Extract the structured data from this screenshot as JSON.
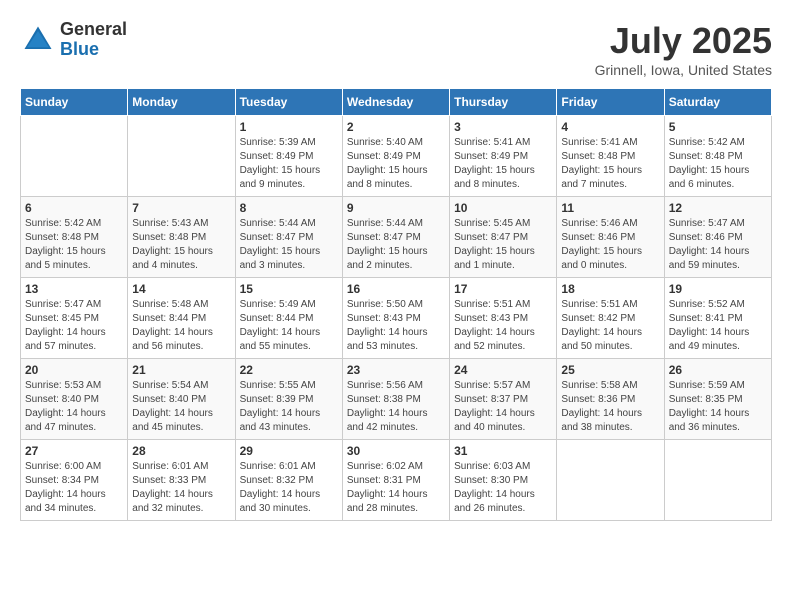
{
  "header": {
    "logo_general": "General",
    "logo_blue": "Blue",
    "month_year": "July 2025",
    "location": "Grinnell, Iowa, United States"
  },
  "days_of_week": [
    "Sunday",
    "Monday",
    "Tuesday",
    "Wednesday",
    "Thursday",
    "Friday",
    "Saturday"
  ],
  "weeks": [
    [
      {
        "day": "",
        "info": ""
      },
      {
        "day": "",
        "info": ""
      },
      {
        "day": "1",
        "info": "Sunrise: 5:39 AM\nSunset: 8:49 PM\nDaylight: 15 hours and 9 minutes."
      },
      {
        "day": "2",
        "info": "Sunrise: 5:40 AM\nSunset: 8:49 PM\nDaylight: 15 hours and 8 minutes."
      },
      {
        "day": "3",
        "info": "Sunrise: 5:41 AM\nSunset: 8:49 PM\nDaylight: 15 hours and 8 minutes."
      },
      {
        "day": "4",
        "info": "Sunrise: 5:41 AM\nSunset: 8:48 PM\nDaylight: 15 hours and 7 minutes."
      },
      {
        "day": "5",
        "info": "Sunrise: 5:42 AM\nSunset: 8:48 PM\nDaylight: 15 hours and 6 minutes."
      }
    ],
    [
      {
        "day": "6",
        "info": "Sunrise: 5:42 AM\nSunset: 8:48 PM\nDaylight: 15 hours and 5 minutes."
      },
      {
        "day": "7",
        "info": "Sunrise: 5:43 AM\nSunset: 8:48 PM\nDaylight: 15 hours and 4 minutes."
      },
      {
        "day": "8",
        "info": "Sunrise: 5:44 AM\nSunset: 8:47 PM\nDaylight: 15 hours and 3 minutes."
      },
      {
        "day": "9",
        "info": "Sunrise: 5:44 AM\nSunset: 8:47 PM\nDaylight: 15 hours and 2 minutes."
      },
      {
        "day": "10",
        "info": "Sunrise: 5:45 AM\nSunset: 8:47 PM\nDaylight: 15 hours and 1 minute."
      },
      {
        "day": "11",
        "info": "Sunrise: 5:46 AM\nSunset: 8:46 PM\nDaylight: 15 hours and 0 minutes."
      },
      {
        "day": "12",
        "info": "Sunrise: 5:47 AM\nSunset: 8:46 PM\nDaylight: 14 hours and 59 minutes."
      }
    ],
    [
      {
        "day": "13",
        "info": "Sunrise: 5:47 AM\nSunset: 8:45 PM\nDaylight: 14 hours and 57 minutes."
      },
      {
        "day": "14",
        "info": "Sunrise: 5:48 AM\nSunset: 8:44 PM\nDaylight: 14 hours and 56 minutes."
      },
      {
        "day": "15",
        "info": "Sunrise: 5:49 AM\nSunset: 8:44 PM\nDaylight: 14 hours and 55 minutes."
      },
      {
        "day": "16",
        "info": "Sunrise: 5:50 AM\nSunset: 8:43 PM\nDaylight: 14 hours and 53 minutes."
      },
      {
        "day": "17",
        "info": "Sunrise: 5:51 AM\nSunset: 8:43 PM\nDaylight: 14 hours and 52 minutes."
      },
      {
        "day": "18",
        "info": "Sunrise: 5:51 AM\nSunset: 8:42 PM\nDaylight: 14 hours and 50 minutes."
      },
      {
        "day": "19",
        "info": "Sunrise: 5:52 AM\nSunset: 8:41 PM\nDaylight: 14 hours and 49 minutes."
      }
    ],
    [
      {
        "day": "20",
        "info": "Sunrise: 5:53 AM\nSunset: 8:40 PM\nDaylight: 14 hours and 47 minutes."
      },
      {
        "day": "21",
        "info": "Sunrise: 5:54 AM\nSunset: 8:40 PM\nDaylight: 14 hours and 45 minutes."
      },
      {
        "day": "22",
        "info": "Sunrise: 5:55 AM\nSunset: 8:39 PM\nDaylight: 14 hours and 43 minutes."
      },
      {
        "day": "23",
        "info": "Sunrise: 5:56 AM\nSunset: 8:38 PM\nDaylight: 14 hours and 42 minutes."
      },
      {
        "day": "24",
        "info": "Sunrise: 5:57 AM\nSunset: 8:37 PM\nDaylight: 14 hours and 40 minutes."
      },
      {
        "day": "25",
        "info": "Sunrise: 5:58 AM\nSunset: 8:36 PM\nDaylight: 14 hours and 38 minutes."
      },
      {
        "day": "26",
        "info": "Sunrise: 5:59 AM\nSunset: 8:35 PM\nDaylight: 14 hours and 36 minutes."
      }
    ],
    [
      {
        "day": "27",
        "info": "Sunrise: 6:00 AM\nSunset: 8:34 PM\nDaylight: 14 hours and 34 minutes."
      },
      {
        "day": "28",
        "info": "Sunrise: 6:01 AM\nSunset: 8:33 PM\nDaylight: 14 hours and 32 minutes."
      },
      {
        "day": "29",
        "info": "Sunrise: 6:01 AM\nSunset: 8:32 PM\nDaylight: 14 hours and 30 minutes."
      },
      {
        "day": "30",
        "info": "Sunrise: 6:02 AM\nSunset: 8:31 PM\nDaylight: 14 hours and 28 minutes."
      },
      {
        "day": "31",
        "info": "Sunrise: 6:03 AM\nSunset: 8:30 PM\nDaylight: 14 hours and 26 minutes."
      },
      {
        "day": "",
        "info": ""
      },
      {
        "day": "",
        "info": ""
      }
    ]
  ]
}
